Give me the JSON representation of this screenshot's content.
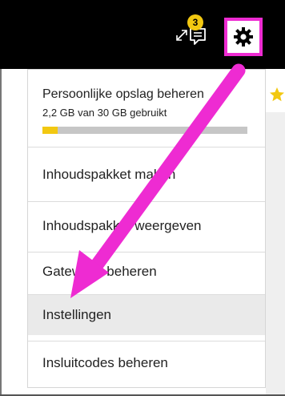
{
  "toolbar": {
    "expand_icon": "expand-icon",
    "comment_icon": "comment-icon",
    "notification_count": "3",
    "settings_icon": "gear-icon"
  },
  "storage": {
    "title": "Persoonlijke opslag beheren",
    "usage": "2,2 GB van 30 GB gebruikt",
    "used_fraction": 0.073
  },
  "menu": {
    "items": [
      {
        "label": "Inhoudspakket maken"
      },
      {
        "label": "Inhoudspakket weergeven"
      },
      {
        "label": "Gateways beheren"
      },
      {
        "label": "Instellingen"
      },
      {
        "label": "Insluitcodes beheren"
      }
    ],
    "selected_index": 3
  },
  "colors": {
    "toolbar_bg": "#000000",
    "accent_yellow": "#f2c811",
    "highlight_magenta": "#ee2bd2",
    "selected_bg": "#eaeaea"
  }
}
